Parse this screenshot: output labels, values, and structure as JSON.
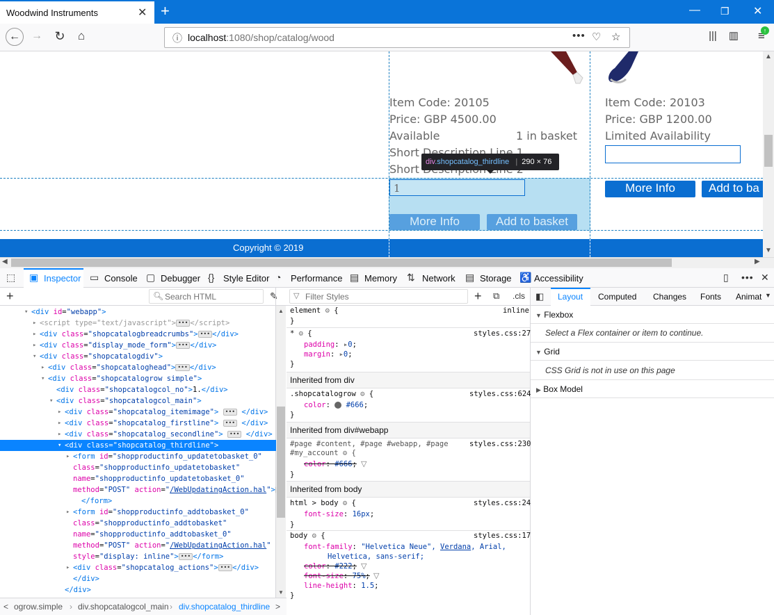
{
  "browser": {
    "tab_title": "Woodwind Instruments",
    "url_host": "localhost",
    "url_path": ":1080/shop/catalog/wood"
  },
  "page": {
    "item1": {
      "code": "Item Code: 20105",
      "price": "Price: GBP 4500.00",
      "availability": "Available",
      "basket": "1 in basket",
      "short1": "Short Description Line 1",
      "short2": "Short Description Line 2",
      "qty": "1",
      "more_info": "More Info",
      "add_to_basket": "Add to basket"
    },
    "item2": {
      "code": "Item Code: 20103",
      "price": "Price: GBP 1200.00",
      "availability": "Limited Availability",
      "more_info": "More Info",
      "add_to_basket": "Add to ba"
    },
    "footer": "Copyright © 2019",
    "tooltip_tag": "div",
    "tooltip_class": ".shopcatalog_thirdline",
    "tooltip_size": "290 × 76"
  },
  "devtools": {
    "tabs": [
      "Inspector",
      "Console",
      "Debugger",
      "Style Editor",
      "Performance",
      "Memory",
      "Network",
      "Storage",
      "Accessibility"
    ],
    "search_placeholder": "Search HTML",
    "filter_placeholder": "Filter Styles",
    "cls": ".cls",
    "markup": [
      {
        "indent": 36,
        "arrow": "▾",
        "html": "<span class='tag'>&lt;div</span> <span class='attr'>id</span>=<span class='val'>\"webapp\"</span><span class='tag'>&gt;</span>"
      },
      {
        "indent": 48,
        "arrow": "▸",
        "html": "<span style='color:#999'>&lt;script type=\"text/javascript\"&gt;</span><span class='ellip'>•••</span><span style='color:#999'>&lt;/script&gt;</span>"
      },
      {
        "indent": 48,
        "arrow": "▸",
        "html": "<span class='tag'>&lt;div</span> <span class='attr'>class</span>=<span class='val'>\"shopcatalogbreadcrumbs\"</span><span class='tag'>&gt;</span><span class='ellip'>•••</span><span class='tag'>&lt;/div&gt;</span>"
      },
      {
        "indent": 48,
        "arrow": "▸",
        "html": "<span class='tag'>&lt;div</span> <span class='attr'>class</span>=<span class='val'>\"display_mode_form\"</span><span class='tag'>&gt;</span><span class='ellip'>•••</span><span class='tag'>&lt;/div&gt;</span>"
      },
      {
        "indent": 48,
        "arrow": "▾",
        "html": "<span class='tag'>&lt;div</span> <span class='attr'>class</span>=<span class='val'>\"shopcatalogdiv\"</span><span class='tag'>&gt;</span>"
      },
      {
        "indent": 60,
        "arrow": "▸",
        "html": "<span class='tag'>&lt;div</span> <span class='attr'>class</span>=<span class='val'>\"shopcataloghead\"</span><span class='tag'>&gt;</span><span class='ellip'>•••</span><span class='tag'>&lt;/div&gt;</span>"
      },
      {
        "indent": 60,
        "arrow": "▾",
        "html": "<span class='tag'>&lt;div</span> <span class='attr'>class</span>=<span class='val'>\"shopcatalogrow simple\"</span><span class='tag'>&gt;</span>"
      },
      {
        "indent": 72,
        "arrow": "",
        "html": "<span class='tag'>&lt;div</span> <span class='attr'>class</span>=<span class='val'>\"shopcatalogcol_no\"</span><span class='tag'>&gt;</span>1.<span class='tag'>&lt;/div&gt;</span>"
      },
      {
        "indent": 72,
        "arrow": "▾",
        "html": "<span class='tag'>&lt;div</span> <span class='attr'>class</span>=<span class='val'>\"shopcatalogcol_main\"</span><span class='tag'>&gt;</span>"
      },
      {
        "indent": 84,
        "arrow": "▸",
        "html": "<span class='tag'>&lt;div</span> <span class='attr'>class</span>=<span class='val'>\"shopcatalog_itemimage\"</span><span class='tag'>&gt;</span> <span class='ellip'>•••</span> <span class='tag'>&lt;/div&gt;</span>"
      },
      {
        "indent": 84,
        "arrow": "▸",
        "html": "<span class='tag'>&lt;div</span> <span class='attr'>class</span>=<span class='val'>\"shopcatalog_firstline\"</span><span class='tag'>&gt;</span> <span class='ellip'>•••</span> <span class='tag'>&lt;/div&gt;</span>"
      },
      {
        "indent": 84,
        "arrow": "▸",
        "html": "<span class='tag'>&lt;div</span> <span class='attr'>class</span>=<span class='val'>\"shopcatalog_secondline\"</span><span class='tag'>&gt;</span> <span class='ellip'>•••</span> <span class='tag'>&lt;/div&gt;</span>"
      },
      {
        "indent": 84,
        "arrow": "▾",
        "selected": true,
        "html": "<span class='tag'>&lt;div</span> <span class='attr'>class</span>=<span class='val'>\"shopcatalog_thirdline\"</span><span class='tag'>&gt;</span>"
      },
      {
        "indent": 96,
        "arrow": "▸",
        "html": "<span class='tag'>&lt;form</span> <span class='attr'>id</span>=<span class='val'>\"shopproductinfo_updatetobasket_0\"</span>"
      },
      {
        "indent": 96,
        "arrow": "",
        "html": "<span class='attr'>class</span>=<span class='val'>\"shopproductinfo_updatetobasket\"</span>"
      },
      {
        "indent": 96,
        "arrow": "",
        "html": "<span class='attr'>name</span>=<span class='val'>\"shopproductinfo_updatetobasket_0\"</span>"
      },
      {
        "indent": 96,
        "arrow": "",
        "html": "<span class='attr'>method</span>=<span class='val'>\"POST\"</span> <span class='attr'>action</span>=<span class='val'>\"<u>/WebUpdatingAction.hal</u>\"</span><span class='tag'>&gt;</span><span class='ellip'>•••</span>"
      },
      {
        "indent": 108,
        "arrow": "",
        "html": "<span class='tag'>&lt;/form&gt;</span>"
      },
      {
        "indent": 96,
        "arrow": "▸",
        "html": "<span class='tag'>&lt;form</span> <span class='attr'>id</span>=<span class='val'>\"shopproductinfo_addtobasket_0\"</span>"
      },
      {
        "indent": 96,
        "arrow": "",
        "html": "<span class='attr'>class</span>=<span class='val'>\"shopproductinfo_addtobasket\"</span>"
      },
      {
        "indent": 96,
        "arrow": "",
        "html": "<span class='attr'>name</span>=<span class='val'>\"shopproductinfo_addtobasket_0\"</span>"
      },
      {
        "indent": 96,
        "arrow": "",
        "html": "<span class='attr'>method</span>=<span class='val'>\"POST\"</span> <span class='attr'>action</span>=<span class='val'>\"<u>/WebUpdatingAction.hal</u>\"</span>"
      },
      {
        "indent": 96,
        "arrow": "",
        "html": "<span class='attr'>style</span>=<span class='val'>\"display: inline\"</span><span class='tag'>&gt;</span><span class='ellip'>•••</span><span class='tag'>&lt;/form&gt;</span>"
      },
      {
        "indent": 96,
        "arrow": "▸",
        "html": "<span class='tag'>&lt;div</span> <span class='attr'>class</span>=<span class='val'>\"shopcatalog_actions\"</span><span class='tag'>&gt;</span><span class='ellip'>•••</span><span class='tag'>&lt;/div&gt;</span>"
      },
      {
        "indent": 96,
        "arrow": "",
        "html": "<span class='tag'>&lt;/div&gt;</span>"
      },
      {
        "indent": 84,
        "arrow": "",
        "html": "<span class='tag'>&lt;/div&gt;</span>"
      },
      {
        "indent": 72,
        "arrow": "",
        "html": "<span class='tag'>&lt;/div&gt;</span>"
      }
    ],
    "breadcrumbs": [
      "ogrow.simple",
      "div.shopcatalogcol_main",
      "div.shopcatalog_thirdline"
    ],
    "layout_tabs": [
      "Layout",
      "Computed",
      "Changes",
      "Fonts",
      "Animat"
    ],
    "flexbox_title": "Flexbox",
    "flexbox_msg": "Select a Flex container or item to continue.",
    "grid_title": "Grid",
    "grid_msg": "CSS Grid is not in use on this page",
    "boxmodel_title": "Box Model",
    "rules": {
      "element_sel": "element",
      "element_src": "inline",
      "star_sel": "*",
      "star_src": "styles.css:27",
      "padding": "padding",
      "margin": "margin",
      "zero": "0",
      "inh_div": "Inherited from div",
      "row_sel": ".shopcatalogrow",
      "row_src": "styles.css:624",
      "color": "color",
      "c666": "#666",
      "inh_webapp": "Inherited from div#webapp",
      "page_sel1": "#page #content, #page #webapp, #page",
      "page_sel2": "#my_account",
      "page_src": "styles.css:230",
      "inh_body": "Inherited from body",
      "html_sel": "html > body",
      "html_src": "styles.css:24",
      "font_size": "font-size",
      "fs16": "16px",
      "body_sel": "body",
      "body_src": "styles.css:17",
      "font_family": "font-family",
      "ff1": "\"Helvetica Neue\",",
      "ff_verdana": "Verdana",
      "ff_arial": ", Arial,",
      "ff2": "Helvetica, sans-serif;",
      "c222": "#222",
      "fs75": "75%",
      "line_height": "line-height",
      "lh": "1.5"
    }
  }
}
